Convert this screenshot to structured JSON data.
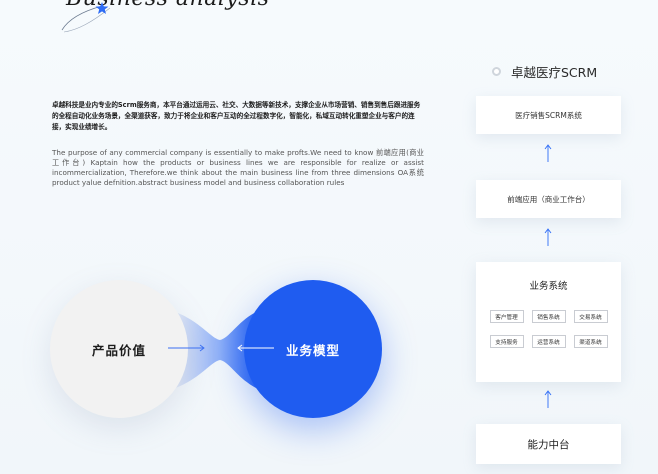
{
  "hero": {
    "script_title": "Business analysis"
  },
  "intro": {
    "cn_text": "卓越科技是业内专业的Scrm服务商，本平台通过运用云、社交、大数据等新技术，支撑企业从市场营销、销售到售后跟进服务的全程自动化业务场景，全渠道获客，致力于将企业和客户互动的全过程数字化，智能化，私域互动转化重塑企业与客户的连接，实现业绩增长。",
    "en_text": "The purpose of any commercial company is essentially to make profts.We need to know 前端应用(商业工作台) Kaptain how the products or business lines we are responsible for realize or assist incommercialization, Therefore.we think about the main business line from three dimensions OA系统 product yalue defnition.abstract business model and business collaboration rules"
  },
  "circles": {
    "left_label": "产品价值",
    "right_label": "业务模型"
  },
  "scrm": {
    "title": "卓越医疗SCRM",
    "card1": "医疗销售SCRM系统",
    "card2": "前端应用（商业工作台）",
    "card3_title": "业务系统",
    "chips": [
      "客户管理",
      "销售系统",
      "交易系统",
      "支持服务",
      "运营系统",
      "渠道系统"
    ],
    "card4": "能力中台"
  },
  "colors": {
    "accent": "#1f5cf0",
    "light_circle": "#f2f2f2"
  }
}
